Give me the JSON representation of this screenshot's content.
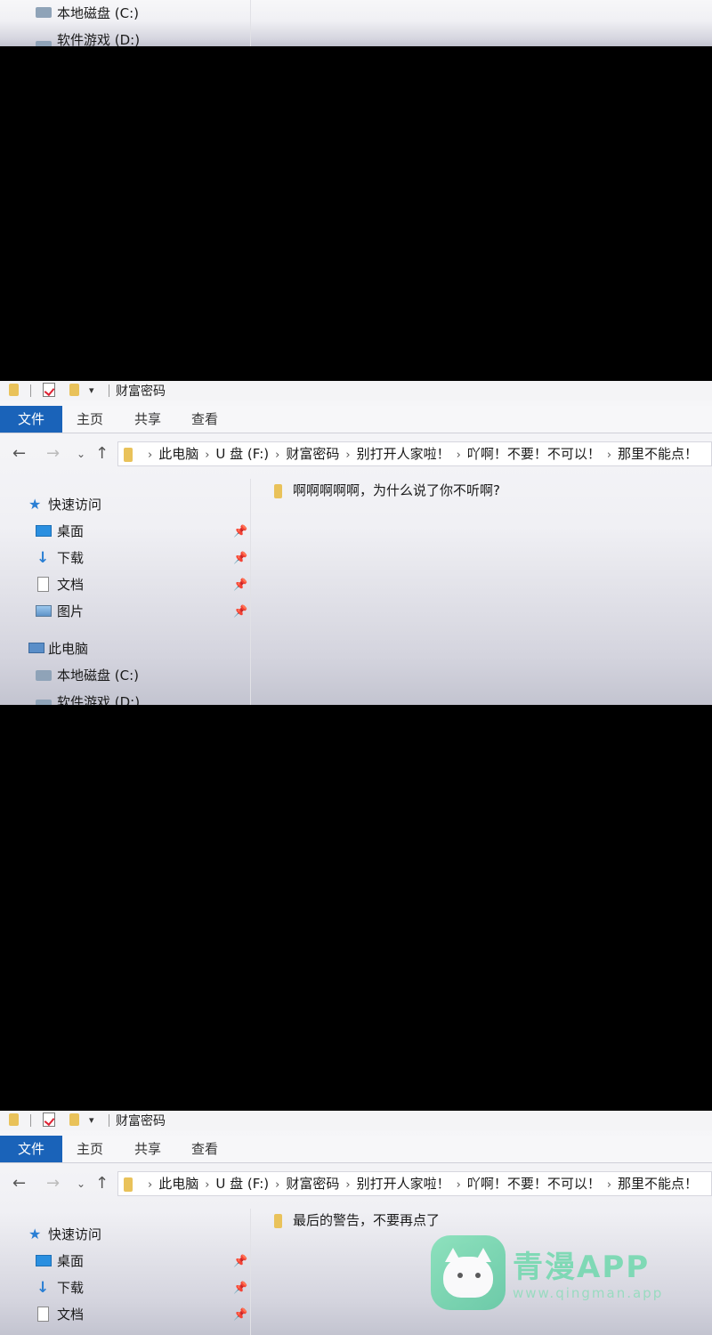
{
  "explorer": {
    "window_title": "财富密码",
    "ribbon_tabs": [
      "文件",
      "主页",
      "共享",
      "查看"
    ],
    "breadcrumb": [
      "此电脑",
      "U 盘 (F:)",
      "财富密码",
      "别打开人家啦！",
      "吖啊！不要！不可以！",
      "那里不能点！"
    ],
    "quick_access": "快速访问",
    "pinned": [
      "桌面",
      "下载",
      "文档",
      "图片"
    ],
    "this_pc": "此电脑",
    "drives": [
      "本地磁盘 (C:)",
      "软件游戏 (D:)"
    ]
  },
  "frames": [
    {
      "folder_item": ""
    },
    {
      "folder_item": "啊啊啊啊啊，为什么说了你不听啊?"
    },
    {
      "folder_item": "最后的警告，不要再点了"
    }
  ],
  "watermark": {
    "name": "青漫APP",
    "url": "www.qingman.app"
  },
  "colors": {
    "file_tab": "#1a63b9",
    "folder": "#e9c25a",
    "pin": "#7a7a7a"
  }
}
